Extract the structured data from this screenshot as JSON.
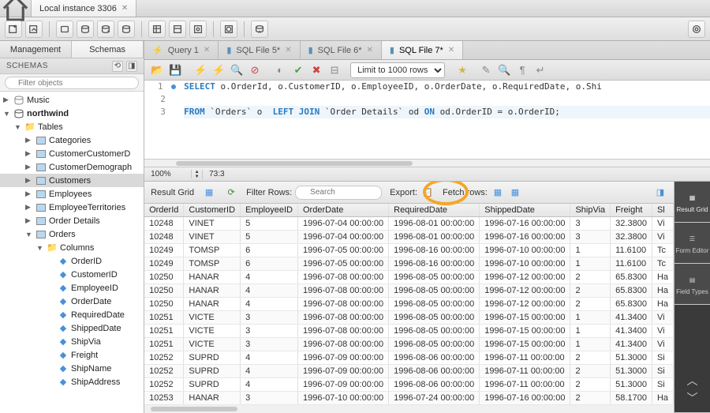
{
  "title_tab": "Local instance 3306",
  "left_tabs": {
    "management": "Management",
    "schemas": "Schemas"
  },
  "schemas_header": "SCHEMAS",
  "search_placeholder": "Filter objects",
  "tree": {
    "db0": "Music",
    "db1": "northwind",
    "tables_label": "Tables",
    "tables": [
      "Categories",
      "CustomerCustomerD",
      "CustomerDemograph",
      "Customers",
      "Employees",
      "EmployeeTerritories",
      "Order Details",
      "Orders"
    ],
    "columns_label": "Columns",
    "columns": [
      "OrderID",
      "CustomerID",
      "EmployeeID",
      "OrderDate",
      "RequiredDate",
      "ShippedDate",
      "ShipVia",
      "Freight",
      "ShipName",
      "ShipAddress"
    ]
  },
  "query_tabs": [
    "Query 1",
    "SQL File 5*",
    "SQL File 6*",
    "SQL File 7*"
  ],
  "limit_label": "Limit to 1000 rows",
  "sql": {
    "l1a": "SELECT",
    "l1b": " o.OrderId, o.CustomerID, o.EmployeeID, o.OrderDate, o.RequiredDate, o.Shi",
    "l3a": "FROM",
    "l3b": " `Orders` o  ",
    "l3c": "LEFT JOIN",
    "l3d": " `Order Details` od ",
    "l3e": "ON",
    "l3f": " od.OrderID = o.OrderID;"
  },
  "zoom": "100%",
  "cursor_pos": "73:3",
  "result_tb": {
    "title": "Result Grid",
    "filter_label": "Filter Rows:",
    "filter_placeholder": "Search",
    "export_label": "Export:",
    "fetch_label": "Fetch rows:"
  },
  "columns_hdr": [
    "OrderId",
    "CustomerID",
    "EmployeeID",
    "OrderDate",
    "RequiredDate",
    "ShippedDate",
    "ShipVia",
    "Freight",
    "Sl"
  ],
  "rows": [
    [
      "10248",
      "VINET",
      "5",
      "1996-07-04 00:00:00",
      "1996-08-01 00:00:00",
      "1996-07-16 00:00:00",
      "3",
      "32.3800",
      "Vi"
    ],
    [
      "10248",
      "VINET",
      "5",
      "1996-07-04 00:00:00",
      "1996-08-01 00:00:00",
      "1996-07-16 00:00:00",
      "3",
      "32.3800",
      "Vi"
    ],
    [
      "10249",
      "TOMSP",
      "6",
      "1996-07-05 00:00:00",
      "1996-08-16 00:00:00",
      "1996-07-10 00:00:00",
      "1",
      "11.6100",
      "Tc"
    ],
    [
      "10249",
      "TOMSP",
      "6",
      "1996-07-05 00:00:00",
      "1996-08-16 00:00:00",
      "1996-07-10 00:00:00",
      "1",
      "11.6100",
      "Tc"
    ],
    [
      "10250",
      "HANAR",
      "4",
      "1996-07-08 00:00:00",
      "1996-08-05 00:00:00",
      "1996-07-12 00:00:00",
      "2",
      "65.8300",
      "Ha"
    ],
    [
      "10250",
      "HANAR",
      "4",
      "1996-07-08 00:00:00",
      "1996-08-05 00:00:00",
      "1996-07-12 00:00:00",
      "2",
      "65.8300",
      "Ha"
    ],
    [
      "10250",
      "HANAR",
      "4",
      "1996-07-08 00:00:00",
      "1996-08-05 00:00:00",
      "1996-07-12 00:00:00",
      "2",
      "65.8300",
      "Ha"
    ],
    [
      "10251",
      "VICTE",
      "3",
      "1996-07-08 00:00:00",
      "1996-08-05 00:00:00",
      "1996-07-15 00:00:00",
      "1",
      "41.3400",
      "Vi"
    ],
    [
      "10251",
      "VICTE",
      "3",
      "1996-07-08 00:00:00",
      "1996-08-05 00:00:00",
      "1996-07-15 00:00:00",
      "1",
      "41.3400",
      "Vi"
    ],
    [
      "10251",
      "VICTE",
      "3",
      "1996-07-08 00:00:00",
      "1996-08-05 00:00:00",
      "1996-07-15 00:00:00",
      "1",
      "41.3400",
      "Vi"
    ],
    [
      "10252",
      "SUPRD",
      "4",
      "1996-07-09 00:00:00",
      "1996-08-06 00:00:00",
      "1996-07-11 00:00:00",
      "2",
      "51.3000",
      "Si"
    ],
    [
      "10252",
      "SUPRD",
      "4",
      "1996-07-09 00:00:00",
      "1996-08-06 00:00:00",
      "1996-07-11 00:00:00",
      "2",
      "51.3000",
      "Si"
    ],
    [
      "10252",
      "SUPRD",
      "4",
      "1996-07-09 00:00:00",
      "1996-08-06 00:00:00",
      "1996-07-11 00:00:00",
      "2",
      "51.3000",
      "Si"
    ],
    [
      "10253",
      "HANAR",
      "3",
      "1996-07-10 00:00:00",
      "1996-07-24 00:00:00",
      "1996-07-16 00:00:00",
      "2",
      "58.1700",
      "Ha"
    ]
  ],
  "side_tools": {
    "result": "Result\nGrid",
    "form": "Form\nEditor",
    "field": "Field\nTypes"
  }
}
